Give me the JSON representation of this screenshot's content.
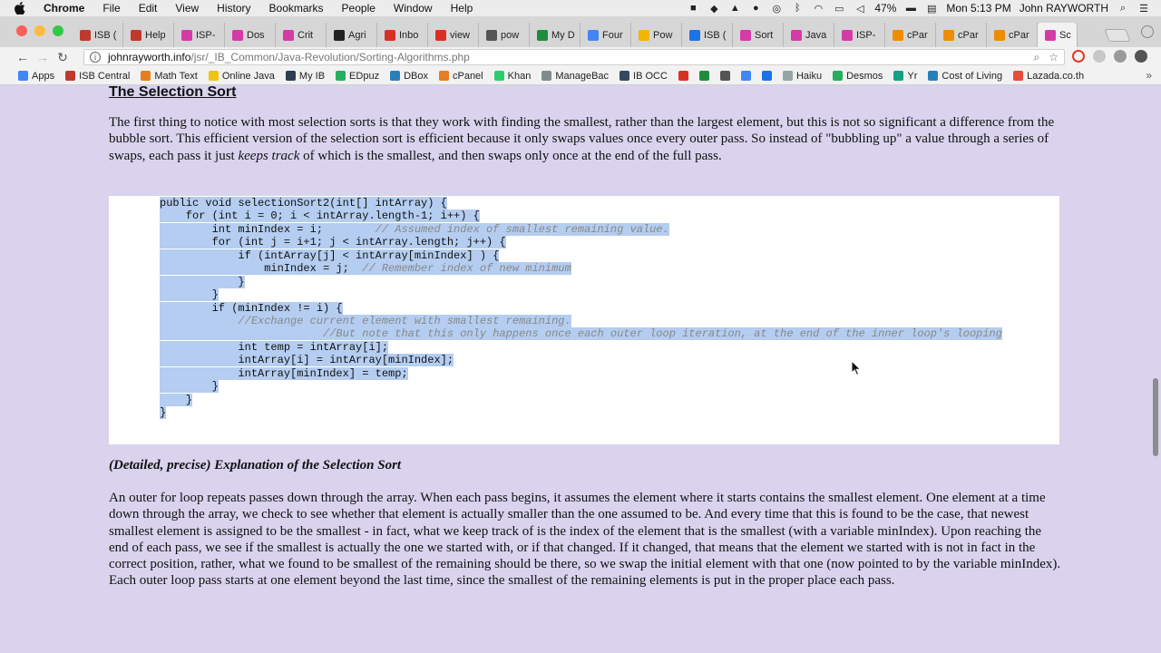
{
  "menubar": {
    "app_name": "Chrome",
    "menus": [
      "File",
      "Edit",
      "View",
      "History",
      "Bookmarks",
      "People",
      "Window",
      "Help"
    ],
    "battery": "47%",
    "clock": "Mon 5:13 PM",
    "user": "John RAYWORTH"
  },
  "tabs": [
    {
      "label": "ISB (",
      "color": "#c0392b"
    },
    {
      "label": "Help",
      "color": "#c0392b"
    },
    {
      "label": "ISP-",
      "color": "#d63aa8"
    },
    {
      "label": "Dos",
      "color": "#d63aa8"
    },
    {
      "label": "Crit",
      "color": "#d63aa8"
    },
    {
      "label": "Agri",
      "color": "#222222"
    },
    {
      "label": "Inbo",
      "color": "#d93025"
    },
    {
      "label": "view",
      "color": "#d93025"
    },
    {
      "label": "pow",
      "color": "#555555"
    },
    {
      "label": "My D",
      "color": "#1e8e3e"
    },
    {
      "label": "Four",
      "color": "#4285f4"
    },
    {
      "label": "Pow",
      "color": "#f4b400"
    },
    {
      "label": "ISB (",
      "color": "#1a73e8"
    },
    {
      "label": "Sort",
      "color": "#d63aa8"
    },
    {
      "label": "Java",
      "color": "#d63aa8"
    },
    {
      "label": "ISP-",
      "color": "#d63aa8"
    },
    {
      "label": "cPar",
      "color": "#f08c00"
    },
    {
      "label": "cPar",
      "color": "#f08c00"
    },
    {
      "label": "cPar",
      "color": "#f08c00"
    }
  ],
  "active_tab": {
    "label": "Sc",
    "color": "#d63aa8"
  },
  "address": {
    "host": "johnrayworth.info",
    "path": "/jsr/_IB_Common/Java-Revolution/Sorting-Algorithms.php"
  },
  "bookmarks": [
    {
      "label": "Apps",
      "color": "#4285f4"
    },
    {
      "label": "ISB Central",
      "color": "#c0392b"
    },
    {
      "label": "Math Text",
      "color": "#e67e22"
    },
    {
      "label": "Online Java",
      "color": "#f1c40f"
    },
    {
      "label": "My IB",
      "color": "#2c3e50"
    },
    {
      "label": "EDpuz",
      "color": "#27ae60"
    },
    {
      "label": "DBox",
      "color": "#2980b9"
    },
    {
      "label": "cPanel",
      "color": "#e67e22"
    },
    {
      "label": "Khan",
      "color": "#2ecc71"
    },
    {
      "label": "ManageBac",
      "color": "#7f8c8d"
    },
    {
      "label": "IB OCC",
      "color": "#34495e"
    },
    {
      "label": "",
      "color": "#d93025"
    },
    {
      "label": "",
      "color": "#1e8e3e"
    },
    {
      "label": "",
      "color": "#555555"
    },
    {
      "label": "",
      "color": "#4285f4"
    },
    {
      "label": "",
      "color": "#1a73e8"
    },
    {
      "label": "Haiku",
      "color": "#95a5a6"
    },
    {
      "label": "Desmos",
      "color": "#27ae60"
    },
    {
      "label": "Yr",
      "color": "#16a085"
    },
    {
      "label": "Cost of Living",
      "color": "#2980b9"
    },
    {
      "label": "Lazada.co.th",
      "color": "#e74c3c"
    }
  ],
  "content": {
    "heading": "The Selection Sort",
    "para1_a": "The first thing to notice with most selection sorts is that they work with finding the smallest, rather than the largest element, but this is not so significant a difference from the bubble sort. This efficient version of the selection sort is efficient because it only swaps values once every outer pass. So instead of \"bubbling up\" a value through a series of swaps, each pass it just ",
    "para1_em": "keeps track",
    "para1_b": " of which is the smallest, and then swaps only once at the end of the full pass.",
    "code_lines": [
      {
        "code": "public void selectionSort2(int[] intArray) {",
        "comment": ""
      },
      {
        "code": "    for (int i = 0; i < intArray.length-1; i++) {",
        "comment": ""
      },
      {
        "code": "        int minIndex = i;        ",
        "comment": "// Assumed index of smallest remaining value."
      },
      {
        "code": "        for (int j = i+1; j < intArray.length; j++) {",
        "comment": ""
      },
      {
        "code": "            if (intArray[j] < intArray[minIndex] ) {",
        "comment": ""
      },
      {
        "code": "                minIndex = j;  ",
        "comment": "// Remember index of new minimum"
      },
      {
        "code": "            }",
        "comment": ""
      },
      {
        "code": "        }",
        "comment": ""
      },
      {
        "code": "        if (minIndex != i) {",
        "comment": ""
      },
      {
        "code": "            ",
        "comment": "//Exchange current element with smallest remaining."
      },
      {
        "code": "                         ",
        "comment": "//But note that this only happens once each outer loop iteration, at the end of the inner loop's looping"
      },
      {
        "code": "            int temp = intArray[i];",
        "comment": ""
      },
      {
        "code": "            intArray[i] = intArray[minIndex];",
        "comment": ""
      },
      {
        "code": "            intArray[minIndex] = temp;",
        "comment": ""
      },
      {
        "code": "        }",
        "comment": ""
      },
      {
        "code": "    }",
        "comment": ""
      },
      {
        "code": "}",
        "comment": ""
      }
    ],
    "explanation_heading": "(Detailed, precise) Explanation of the Selection Sort",
    "para2": "An outer for loop repeats passes down through the array. When each pass begins, it assumes the element where it starts contains the smallest element. One element at a time down through the array, we check to see whether that element is actually smaller than the one assumed to be. And every time that this is found to be the case, that newest smallest element is assigned to be the smallest - in fact, what we keep track of is the index of the element that is the smallest (with a variable minIndex). Upon reaching the end of each pass, we see if the smallest is actually the one we started with, or if that changed. If it changed, that means that the element we started with is not in fact in the correct position, rather, what we found to be smallest of the remaining should be there, so we swap the initial element with that one (now pointed to by the variable minIndex). Each outer loop pass starts at one element beyond the last time, since the smallest of the remaining elements is put in the proper place each pass."
  }
}
